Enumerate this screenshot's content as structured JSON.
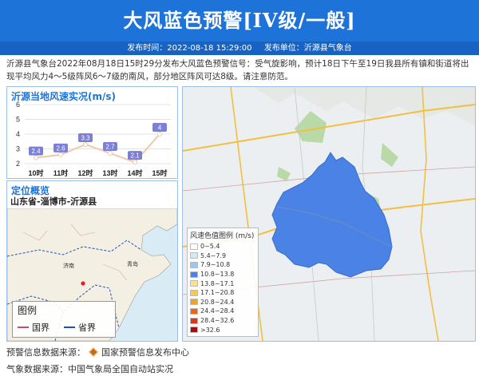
{
  "header": {
    "title": "大风蓝色预警[IV级/一般]",
    "publish_time": "发布时间：2022-08-18 15:29:00",
    "publisher": "发布单位：沂源县气象台"
  },
  "description": "沂源县气象台2022年08月18日15时29分发布大风蓝色预警信号：受气旋影响，预计18日下午至19日我县所有镇和街道将出现平均风力4～5级阵风6～7级的南风，部分地区阵风可达8级。请注意防范。",
  "chart_panel": {
    "title": "沂源当地风速实况(m/s)"
  },
  "chart_data": {
    "type": "line",
    "categories": [
      "10时",
      "11时",
      "12时",
      "13时",
      "14时",
      "15时"
    ],
    "values": [
      2.4,
      2.6,
      3.3,
      2.7,
      2.1,
      4
    ],
    "ylim": [
      2,
      6
    ],
    "yticks": [
      "2",
      "3",
      "4",
      "5",
      "6"
    ],
    "grid": true,
    "colors": {
      "line": "#f0c8a8",
      "label_bg": "#7b7fd6",
      "point": "#ffffff"
    }
  },
  "location_panel": {
    "title": "定位概览",
    "location": "山东省-淄博市-沂源县",
    "legend": {
      "title": "图例",
      "items": [
        {
          "label": "国界",
          "color": "#c0506a"
        },
        {
          "label": "省界",
          "color": "#2050c0"
        }
      ]
    }
  },
  "main_map": {
    "legend_title": "风速色值图例 (m/s)",
    "legend_items": [
      {
        "label": "0~5.4",
        "color": "#ffffff"
      },
      {
        "label": "5.4~7.9",
        "color": "#d4e8f7"
      },
      {
        "label": "7.9~10.8",
        "color": "#9cc7ef"
      },
      {
        "label": "10.8~13.8",
        "color": "#4a82e6"
      },
      {
        "label": "13.8~17.1",
        "color": "#f7e48a"
      },
      {
        "label": "17.1~20.8",
        "color": "#f3c95a"
      },
      {
        "label": "20.8~24.4",
        "color": "#f0a030"
      },
      {
        "label": "24.4~28.4",
        "color": "#e66a1e"
      },
      {
        "label": "28.4~32.6",
        "color": "#d23a1a"
      },
      {
        "label": ">32.6",
        "color": "#a01010"
      }
    ],
    "region_color": "#4a82e6"
  },
  "footer": {
    "warning_source_label": "预警信息数据来源：",
    "warning_source": "国家预警信息发布中心",
    "weather_source": "气象数据来源：中国气象局全国自动站实况"
  }
}
